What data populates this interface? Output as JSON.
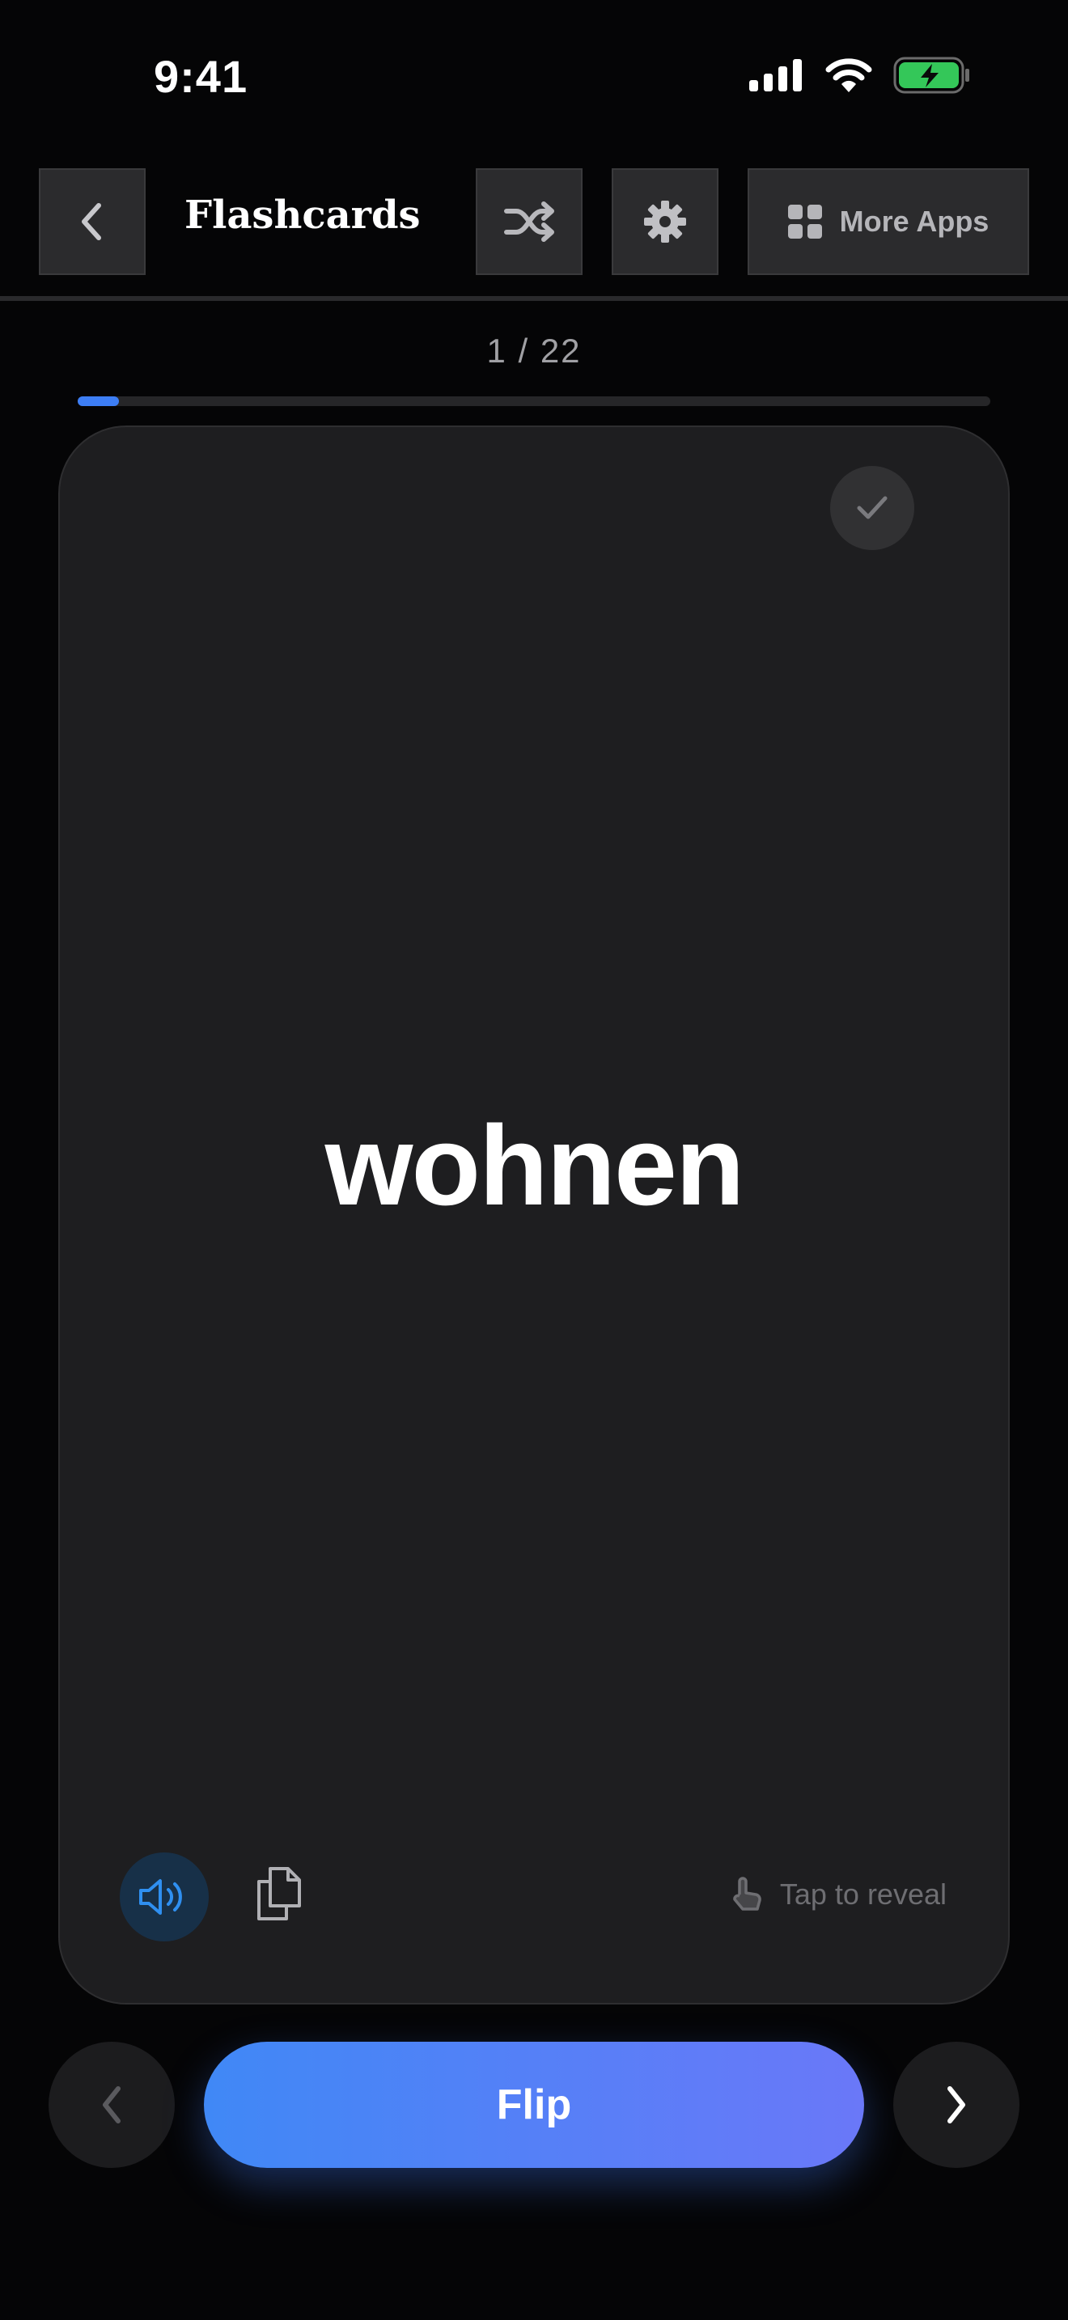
{
  "status_bar": {
    "time": "9:41",
    "icons": [
      "signal-icon",
      "wifi-icon",
      "battery-charging-icon"
    ]
  },
  "header": {
    "title": "Flashcards",
    "back_icon": "chevron-left-icon",
    "shuffle_icon": "shuffle-icon",
    "settings_icon": "gear-icon",
    "more_apps_label": "More Apps",
    "more_apps_icon": "grid-icon"
  },
  "progress": {
    "counter": "1 / 22",
    "current": 1,
    "total": 22
  },
  "card": {
    "word": "wohnen",
    "tap_hint": "Tap to reveal",
    "speaker_icon": "speaker-icon",
    "copy_icon": "copy-icon",
    "check_icon": "checkmark-icon"
  },
  "controls": {
    "flip_label": "Flip",
    "prev_icon": "chevron-left-icon",
    "next_icon": "chevron-right-icon"
  },
  "colors": {
    "accent": "#3d7ef5",
    "flip_gradient_start": "#4088f6",
    "flip_gradient_end": "#6a78f8",
    "card_bg": "#1e1e20",
    "battery_green": "#34c759"
  }
}
